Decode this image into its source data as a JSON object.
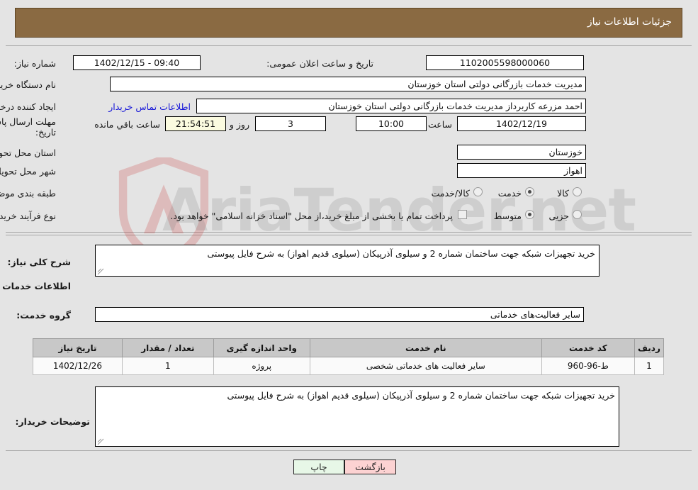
{
  "header": {
    "title": "جزئیات اطلاعات نیاز"
  },
  "watermark": {
    "text": "AriaTender.net",
    "shield_color": "#c9302c"
  },
  "fields": {
    "need_number_label": "شماره نیاز:",
    "need_number_value": "1102005598000060",
    "public_announce_label": "تاریخ و ساعت اعلان عمومی:",
    "public_announce_value": "09:40 - 1402/12/15",
    "buyer_org_label": "نام دستگاه خریدار:",
    "buyer_org_value": "مدیریت خدمات بازرگانی دولتی استان خوزستان",
    "creator_label": "ایجاد کننده درخواست:",
    "creator_value": "احمد مزرعه کاربرداز مدیریت خدمات بازرگانی دولتی استان خوزستان",
    "contact_link": "اطلاعات تماس خریدار",
    "deadline_label": "مهلت ارسال پاسخ: تا تاریخ:",
    "deadline_date": "1402/12/19",
    "deadline_time_label": "ساعت",
    "deadline_time": "10:00",
    "days_value": "3",
    "days_label": "روز و",
    "timer_value": "21:54:51",
    "timer_label": "ساعت باقي مانده",
    "province_label": "استان محل تحویل:",
    "province_value": "خوزستان",
    "city_label": "شهر محل تحویل:",
    "city_value": "اهواز",
    "category_label": "طبقه بندی موضوعی:",
    "category_options": [
      "کالا",
      "خدمت",
      "کالا/خدمت"
    ],
    "category_selected": "خدمت",
    "process_label": "نوع فرآیند خرید :",
    "process_options": [
      "جزیی",
      "متوسط"
    ],
    "process_selected": "متوسط",
    "treasury_checkbox_checked": false,
    "treasury_text": "پرداخت تمام یا بخشی از مبلغ خرید،از محل \"اسناد خزانه اسلامی\" خواهد بود."
  },
  "summary": {
    "label": "شرح کلی نیاز:",
    "value": "خرید تجهیزات شبکه جهت ساختمان شماره 2 و سیلوی آذرپیکان  (سیلوی قدیم اهواز) به شرح فایل پیوستی"
  },
  "services_section": {
    "heading": "اطلاعات خدمات مورد نیاز",
    "group_label": "گروه خدمت:",
    "group_value": "سایر فعالیت‌های خدماتی"
  },
  "table": {
    "columns": [
      "ردیف",
      "کد خدمت",
      "نام خدمت",
      "واحد اندازه گیری",
      "تعداد / مقدار",
      "تاریخ نیاز"
    ],
    "rows": [
      {
        "row": "1",
        "service_code": "ط-96-960",
        "service_name": "سایر فعالیت های خدماتی شخصی",
        "unit": "پروژه",
        "quantity": "1",
        "need_date": "1402/12/26"
      }
    ]
  },
  "buyer_notes": {
    "label": "توضیحات خریدار:",
    "value": "خرید تجهیزات شبکه جهت ساختمان شماره 2 و سیلوی آذرپیکان  (سیلوی قدیم اهواز) به شرح فایل پیوستی"
  },
  "buttons": {
    "print": "چاپ",
    "back": "بازگشت"
  }
}
